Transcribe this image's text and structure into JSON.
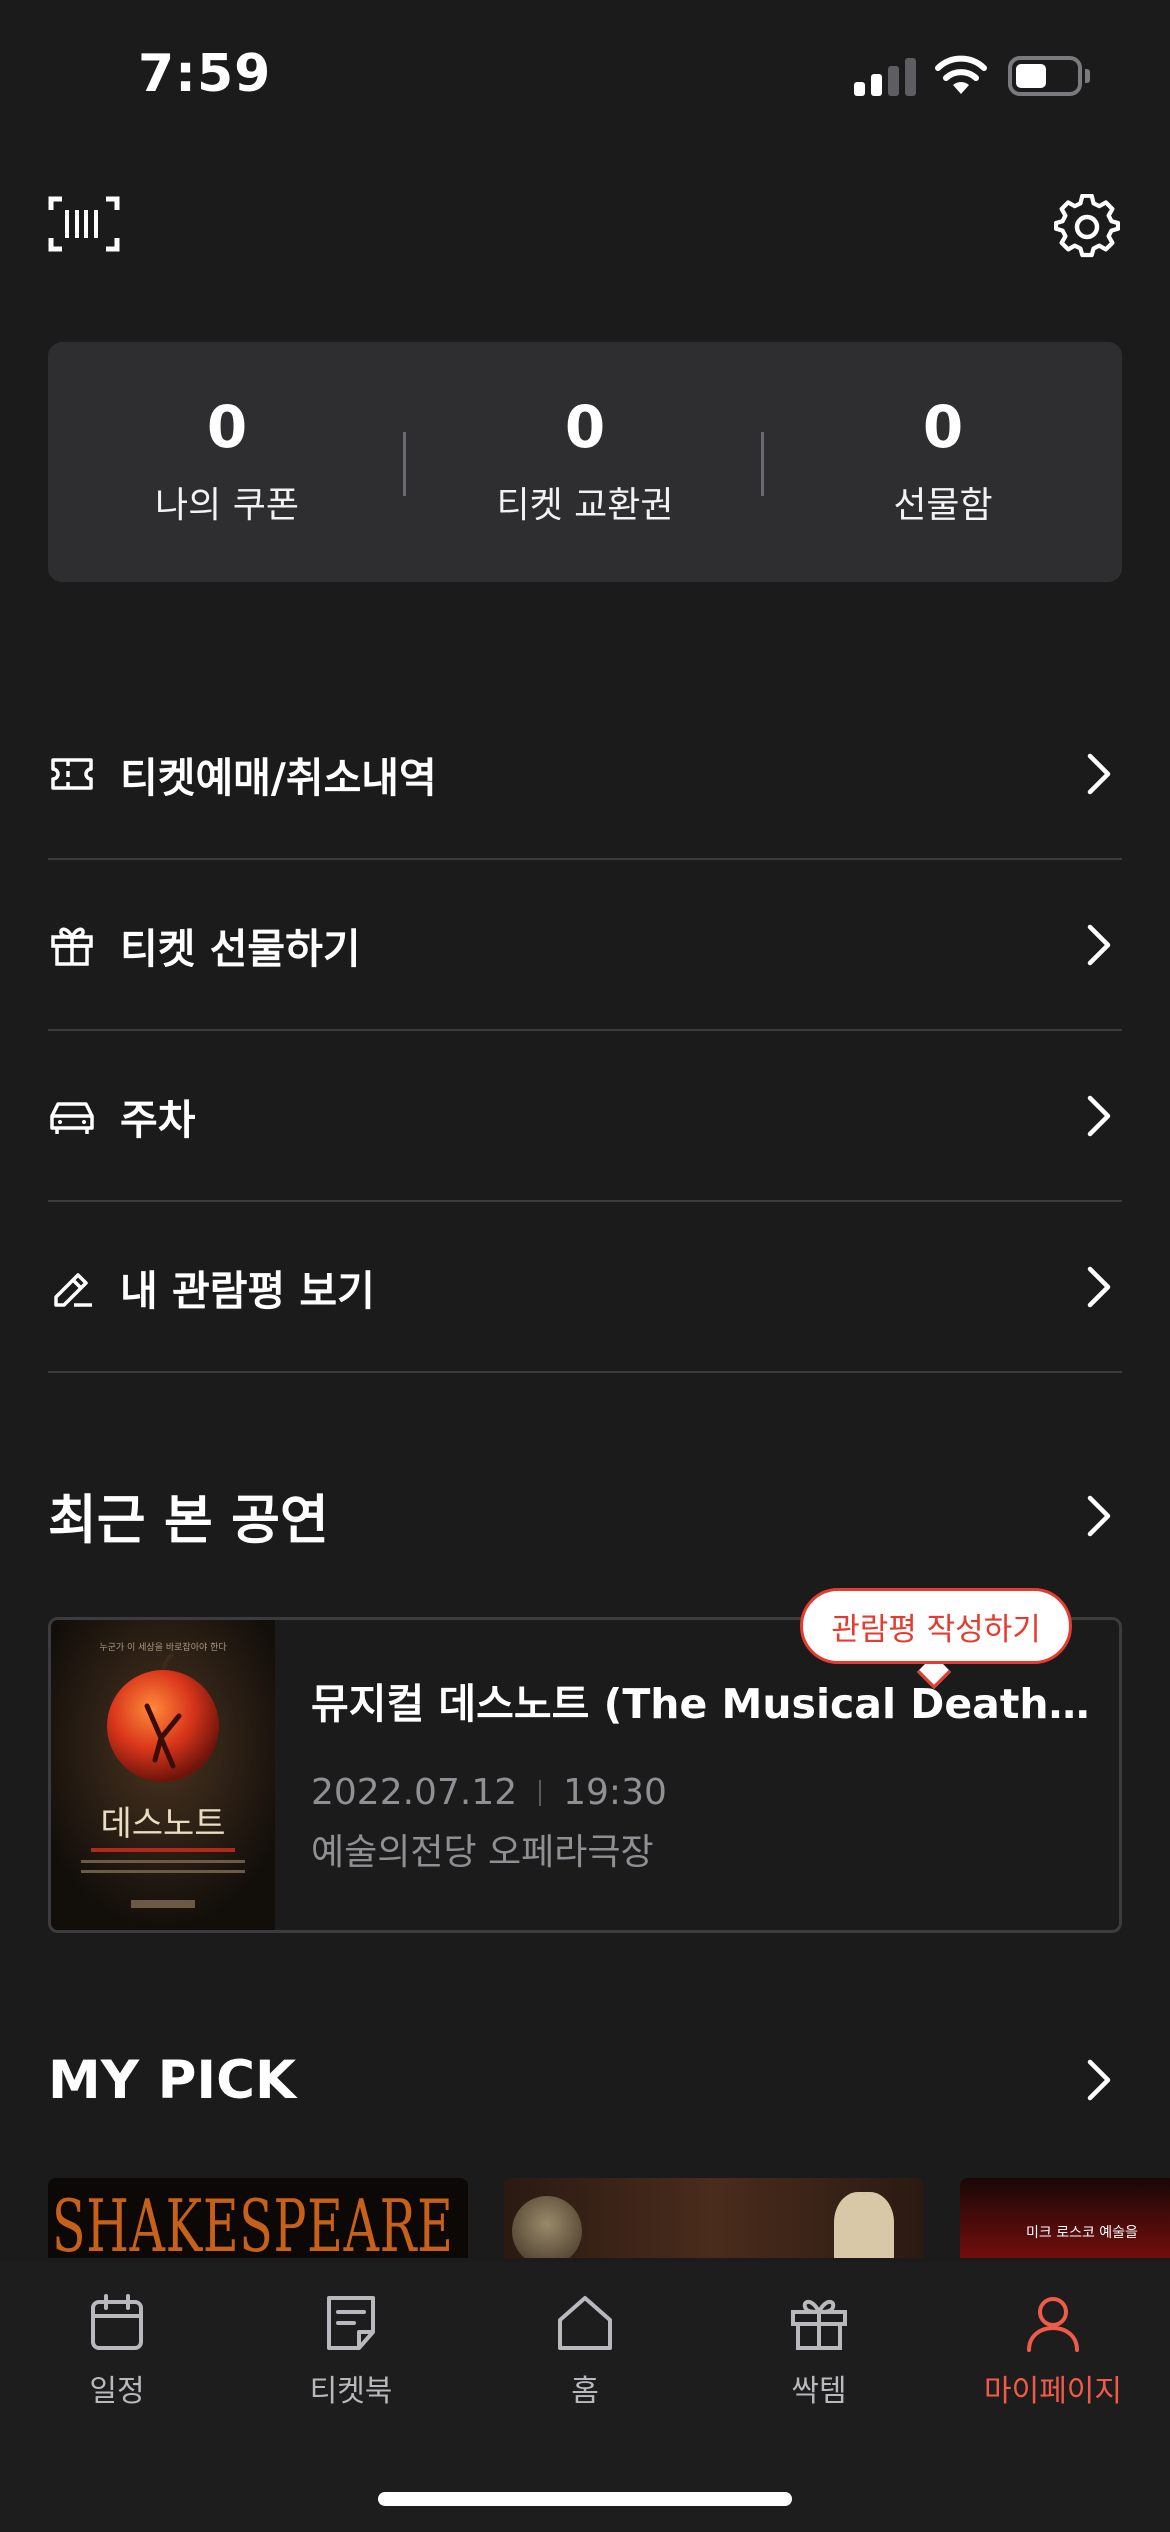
{
  "status_bar": {
    "time": "7:59",
    "signal_bars": 2,
    "battery_level": 0.4
  },
  "top_icons": {
    "left": "barcode-scan-icon",
    "right": "gear-icon"
  },
  "stats": [
    {
      "value": "0",
      "label": "나의 쿠폰"
    },
    {
      "value": "0",
      "label": "티켓 교환권"
    },
    {
      "value": "0",
      "label": "선물함"
    }
  ],
  "menu": [
    {
      "icon": "ticket-icon",
      "label": "티켓예매/취소내역"
    },
    {
      "icon": "gift-icon",
      "label": "티켓 선물하기"
    },
    {
      "icon": "car-icon",
      "label": "주차"
    },
    {
      "icon": "pencil-icon",
      "label": "내 관람평 보기"
    }
  ],
  "recent": {
    "title": "최근 본 공연",
    "review_badge": "관람평 작성하기",
    "show": {
      "title": "뮤지컬 데스노트 (The Musical Death Note)",
      "date": "2022.07.12",
      "time": "19:30",
      "venue": "예술의전당 오페라극장",
      "poster_title": "데스노트",
      "poster_tagline": "누군가 이 세상을 바로잡아야 한다"
    }
  },
  "my_pick": {
    "title": "MY PICK",
    "items": [
      {
        "poster_text": "SHAKESPEARE"
      },
      {
        "poster_text": ""
      },
      {
        "poster_text": "미크 로스코 예술을"
      }
    ]
  },
  "tab_bar": {
    "tabs": [
      {
        "icon": "calendar-icon",
        "label": "일정"
      },
      {
        "icon": "ticketbook-icon",
        "label": "티켓북"
      },
      {
        "icon": "home-icon",
        "label": "홈"
      },
      {
        "icon": "gift-box-icon",
        "label": "싹템"
      },
      {
        "icon": "person-icon",
        "label": "마이페이지"
      }
    ],
    "active_index": 4
  },
  "colors": {
    "accent": "#f05a48",
    "background": "#1b1b1c",
    "card": "#2e2e30"
  }
}
